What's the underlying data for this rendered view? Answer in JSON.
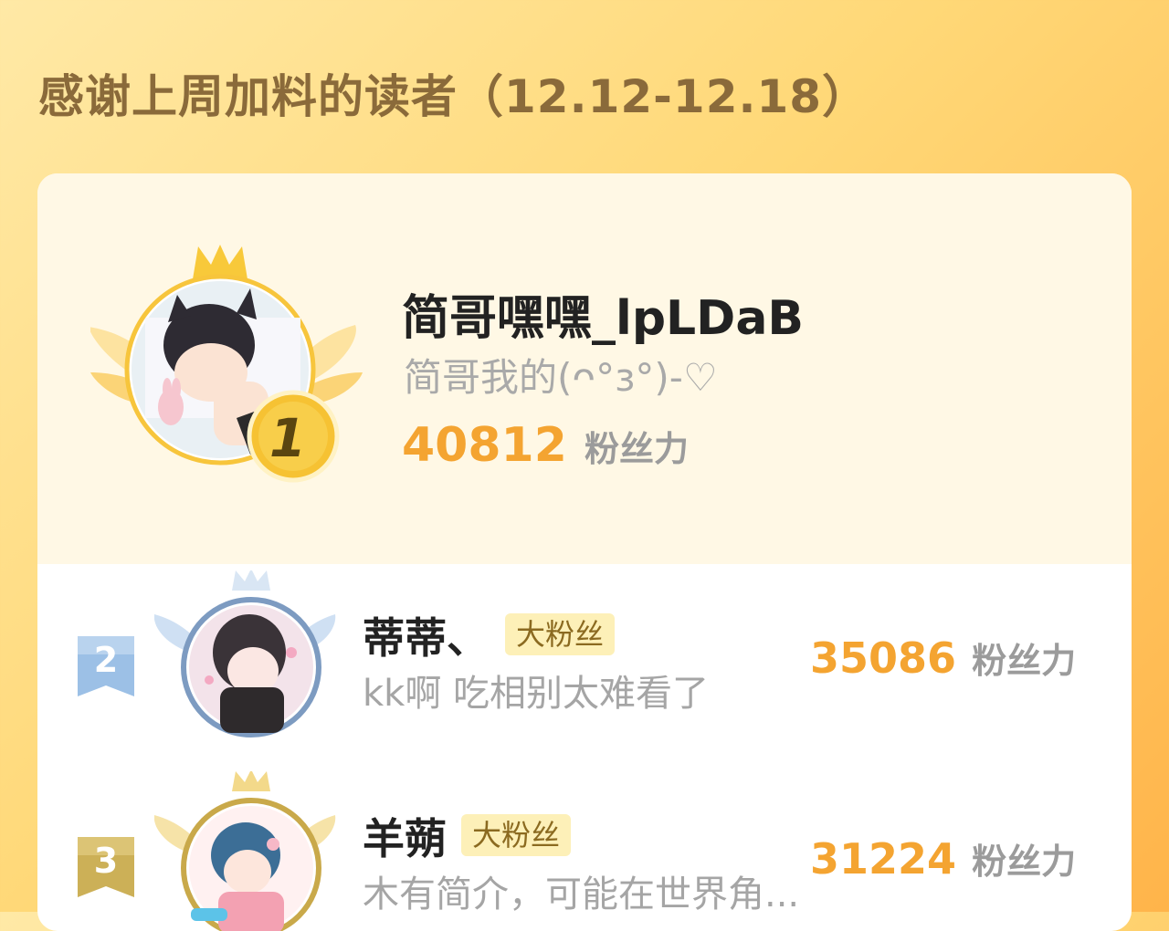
{
  "header": {
    "title": "感谢上周加料的读者（12.12-12.18）"
  },
  "top_reader": {
    "rank": "1",
    "name": "简哥嘿嘿_lpLDaB",
    "bio": "简哥我的(ᴖ°з°)-♡",
    "fans_value": "40812",
    "fans_label": "粉丝力"
  },
  "readers": [
    {
      "rank": "2",
      "name": "蒂蒂、",
      "badge": "大粉丝",
      "bio": "kk啊 吃相别太难看了",
      "fans_value": "35086",
      "fans_label": "粉丝力"
    },
    {
      "rank": "3",
      "name": "羊蒴",
      "badge": "大粉丝",
      "bio": "木有简介，可能在世界角...",
      "fans_value": "31224",
      "fans_label": "粉丝力"
    }
  ],
  "colors": {
    "accent_orange": "#f4a431",
    "gold": "#f6c233",
    "silver_blue": "#8ab0d6",
    "bronze": "#d2b35a"
  },
  "icons": [
    "crown-icon",
    "wings-icon",
    "rank-medal-icon",
    "rank-flag-icon"
  ]
}
